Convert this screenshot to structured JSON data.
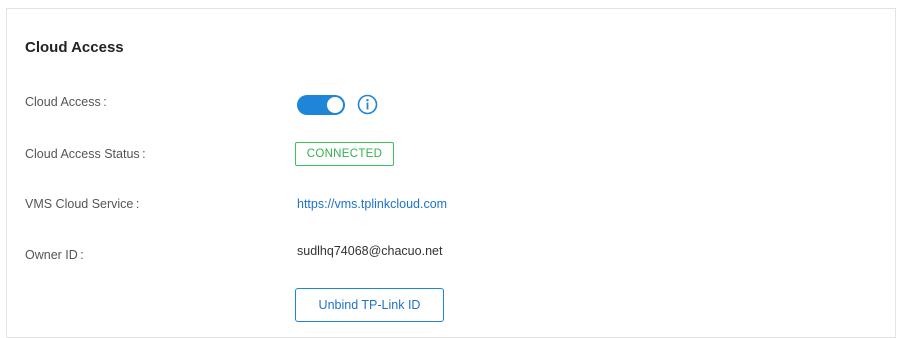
{
  "section": {
    "title": "Cloud Access"
  },
  "cloud_access": {
    "label": "Cloud Access :",
    "enabled": true
  },
  "status": {
    "label": "Cloud Access Status :",
    "value": "CONNECTED"
  },
  "vms": {
    "label": "VMS Cloud Service :",
    "url": "https://vms.tplinkcloud.com"
  },
  "owner": {
    "label": "Owner ID :",
    "value": "sudlhq74068@chacuo.net"
  },
  "actions": {
    "unbind_label": "Unbind TP-Link ID"
  },
  "icons": {
    "info": "info-icon"
  },
  "colors": {
    "accent": "#1e86d6",
    "connected": "#2fb34e",
    "link": "#1e73c8"
  }
}
